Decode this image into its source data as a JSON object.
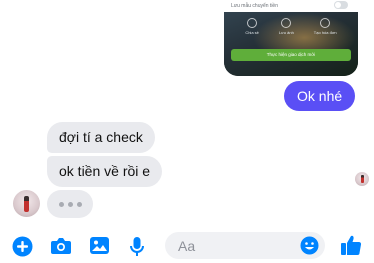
{
  "shared_image": {
    "row_label": "Lưu mẫu chuyển tiền",
    "icons": [
      "Chia sẻ",
      "Lưu ảnh",
      "Tạo hóa đơn"
    ],
    "button_label": "Thực hiện giao dịch mới"
  },
  "messages": {
    "outgoing": [
      {
        "text": "Ok nhé"
      }
    ],
    "incoming": [
      {
        "text": "đợi tí a check"
      },
      {
        "text": "ok tiền về rồi e"
      }
    ]
  },
  "composer": {
    "placeholder": "Aa"
  },
  "colors": {
    "accent": "#0084ff",
    "outgoing_bubble": "#5a4ff5",
    "incoming_bubble": "#e9eaee"
  },
  "icons": [
    "plus-icon",
    "camera-icon",
    "image-icon",
    "microphone-icon",
    "emoji-icon",
    "like-icon"
  ]
}
